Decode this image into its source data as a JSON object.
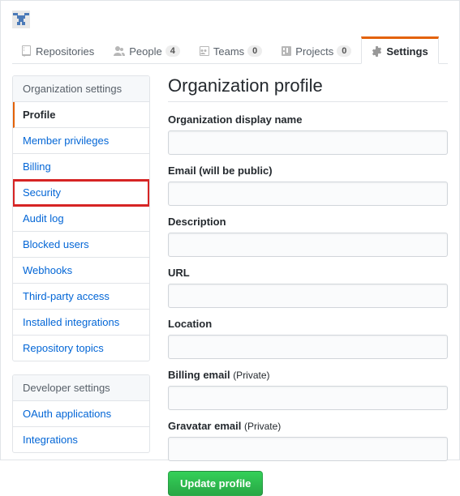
{
  "tabs": {
    "repositories": {
      "label": "Repositories"
    },
    "people": {
      "label": "People",
      "count": "4"
    },
    "teams": {
      "label": "Teams",
      "count": "0"
    },
    "projects": {
      "label": "Projects",
      "count": "0"
    },
    "settings": {
      "label": "Settings"
    }
  },
  "sidebar": {
    "org_header": "Organization settings",
    "items": {
      "profile": "Profile",
      "member_privileges": "Member privileges",
      "billing": "Billing",
      "security": "Security",
      "audit_log": "Audit log",
      "blocked_users": "Blocked users",
      "webhooks": "Webhooks",
      "third_party": "Third-party access",
      "installed": "Installed integrations",
      "repo_topics": "Repository topics"
    },
    "dev_header": "Developer settings",
    "dev": {
      "oauth": "OAuth applications",
      "integrations": "Integrations"
    }
  },
  "main": {
    "heading": "Organization profile",
    "fields": {
      "display_name": "Organization display name",
      "email": "Email (will be public)",
      "description": "Description",
      "url": "URL",
      "location": "Location",
      "billing_email": "Billing email ",
      "billing_email_sub": "(Private)",
      "gravatar_email": "Gravatar email ",
      "gravatar_email_sub": "(Private)"
    },
    "button": "Update profile"
  }
}
